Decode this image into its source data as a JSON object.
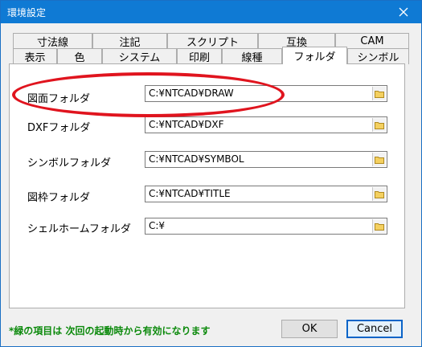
{
  "window": {
    "title": "環境設定"
  },
  "tabs_row1": [
    "寸法線",
    "注記",
    "スクリプト",
    "互換",
    "CAM"
  ],
  "tabs_row2": [
    "表示",
    "色",
    "システム",
    "印刷",
    "線種",
    "フォルダ",
    "シンボル"
  ],
  "active_tab": "フォルダ",
  "folders": [
    {
      "label": "図面フォルダ",
      "value": "C:¥NTCAD¥DRAW"
    },
    {
      "label": "DXFフォルダ",
      "value": "C:¥NTCAD¥DXF"
    },
    {
      "label": "シンボルフォルダ",
      "value": "C:¥NTCAD¥SYMBOL"
    },
    {
      "label": "図枠フォルダ",
      "value": "C:¥NTCAD¥TITLE"
    },
    {
      "label": "シェルホームフォルダ",
      "value": "C:¥"
    }
  ],
  "note": "*緑の項目は 次回の起動時から有効になります",
  "buttons": {
    "ok": "OK",
    "cancel": "Cancel"
  },
  "colors": {
    "titlebar": "#0f7ad4",
    "note": "#0c8a0c",
    "highlight": "#e0141e",
    "folder_icon": "#e8c040"
  },
  "icons": {
    "close": "close-icon",
    "folder": "folder-icon"
  }
}
